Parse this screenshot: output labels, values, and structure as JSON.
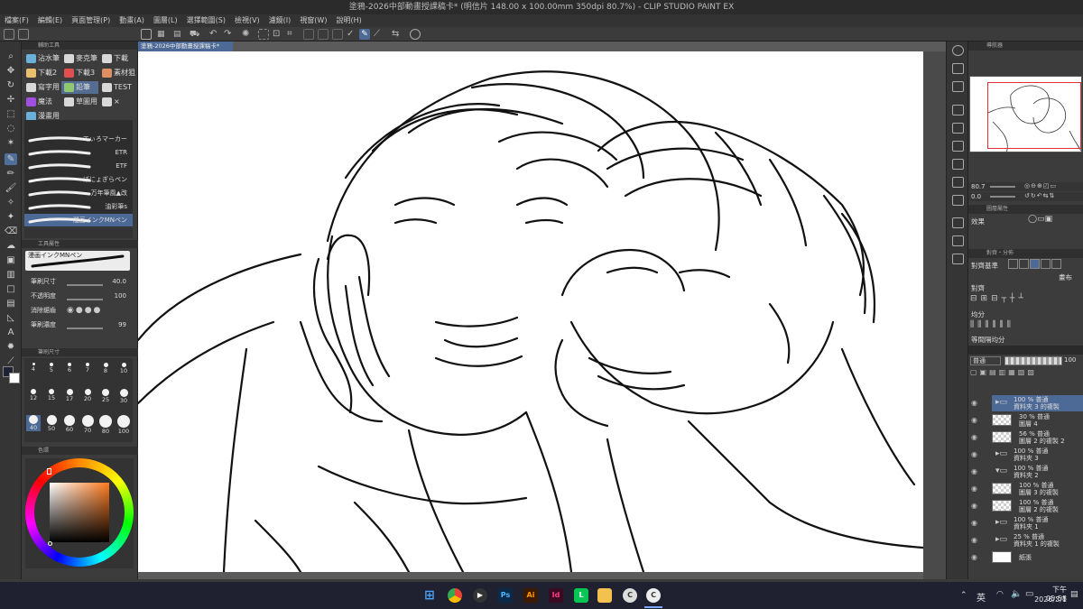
{
  "window": {
    "title": "塗鴉-2026中部動畫授課稿卡* (明信片 148.00 x 100.00mm 350dpi 80.7%) - CLIP STUDIO PAINT EX"
  },
  "menu": [
    "檔案(F)",
    "編輯(E)",
    "頁面管理(P)",
    "動畫(A)",
    "圖層(L)",
    "選擇範圍(S)",
    "檢視(V)",
    "濾鏡(I)",
    "視窗(W)",
    "說明(H)"
  ],
  "subtool_panel": {
    "header": "輔助工具",
    "subtools": [
      {
        "label": "沾水筆",
        "color": "#6ab0d8"
      },
      {
        "label": "麥克筆",
        "color": "#d8d8d8"
      },
      {
        "label": "下載",
        "color": "#d8d8d8"
      },
      {
        "label": "下載2",
        "color": "#e8c070"
      },
      {
        "label": "下載3",
        "color": "#e05050"
      },
      {
        "label": "素材狙",
        "color": "#e09060"
      },
      {
        "label": "寫字用",
        "color": "#d8d8d8"
      },
      {
        "label": "鉛筆",
        "color": "#90c870"
      },
      {
        "label": "TEST",
        "color": "#d8d8d8"
      },
      {
        "label": "魔法",
        "color": "#a050e0"
      },
      {
        "label": "草圖用",
        "color": "#d8d8d8"
      },
      {
        "label": "×",
        "color": "#d8d8d8"
      },
      {
        "label": "漫畫用",
        "color": "#6ab0d8"
      }
    ],
    "brushes": [
      "てぃろマーカー",
      "ETR",
      "ETF",
      "ぼにょぎらペン",
      "万年筆風▲改",
      "油彩筆s",
      "漫画インクMNペン"
    ],
    "properties_header": "工具屬性",
    "current_brush": "漫画インクMNペン",
    "props": [
      {
        "label": "筆刷尺寸",
        "value": "40.0"
      },
      {
        "label": "不透明度",
        "value": "100"
      },
      {
        "label": "消除鋸齒",
        "value": ""
      },
      {
        "label": "筆刷濃度",
        "value": "99"
      }
    ],
    "size_header": "筆刷尺寸",
    "sizes": [
      "4",
      "5",
      "6",
      "7",
      "8",
      "10",
      "12",
      "15",
      "17",
      "20",
      "25",
      "30",
      "40",
      "50",
      "60",
      "70",
      "80",
      "100"
    ],
    "sizes_selected": "40",
    "color_header": "色環"
  },
  "colors": {
    "accent": "#4d6996",
    "main": "#202235",
    "sub": "#ffffff"
  },
  "document": {
    "tab": "塗鴉-2026中部動畫授課稿卡*"
  },
  "navigator": {
    "header": "導航器",
    "zoom": "80.7",
    "angle": "0.0"
  },
  "layer_props": {
    "header": "圖層屬性",
    "effect_label": "效果"
  },
  "align_panel": {
    "header": "對齊・分佈",
    "align_base_label": "對齊基準",
    "target_label": "畫布",
    "align_label": "對齊",
    "distribute_label": "均分",
    "spacing_label": "等間隔均分"
  },
  "layers_panel": {
    "blend": "普通",
    "opacity": "100",
    "layers": [
      {
        "line1": "100 % 普通",
        "line2": "資料夾 3 的複製",
        "type": "folder",
        "selected": true
      },
      {
        "line1": "30 % 普通",
        "line2": "圖層 4",
        "type": "raster",
        "selected": false
      },
      {
        "line1": "56 % 普通",
        "line2": "圖層 2 的複製 2",
        "type": "raster",
        "selected": false
      },
      {
        "line1": "100 % 普通",
        "line2": "資料夾 3",
        "type": "folder",
        "selected": false
      },
      {
        "line1": "100 % 普通",
        "line2": "資料夾 2",
        "type": "folder-open",
        "selected": false
      },
      {
        "line1": "100 % 普通",
        "line2": "圖層 3 的複製",
        "type": "raster",
        "selected": false
      },
      {
        "line1": "100 % 普通",
        "line2": "圖層 2 的複製",
        "type": "raster",
        "selected": false
      },
      {
        "line1": "100 % 普通",
        "line2": "資料夾 1",
        "type": "folder",
        "selected": false
      },
      {
        "line1": "25 % 普通",
        "line2": "資料夾 1 的複製",
        "type": "folder",
        "selected": false
      },
      {
        "line1": "",
        "line2": "紙張",
        "type": "paper",
        "selected": false
      }
    ]
  },
  "taskbar": {
    "ime": "英",
    "time": "下午 05:58",
    "date": "2026/3/1"
  }
}
